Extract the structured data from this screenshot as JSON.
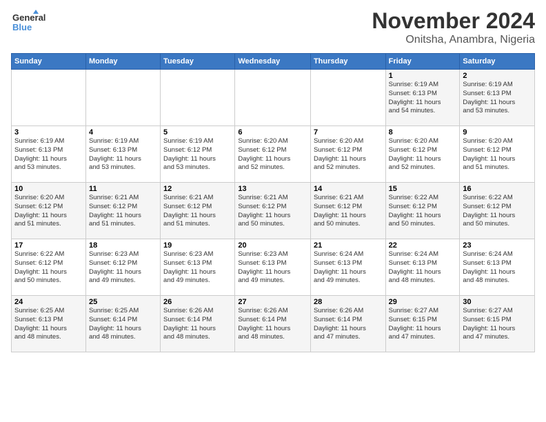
{
  "header": {
    "logo_line1": "General",
    "logo_line2": "Blue",
    "title": "November 2024",
    "subtitle": "Onitsha, Anambra, Nigeria"
  },
  "columns": [
    "Sunday",
    "Monday",
    "Tuesday",
    "Wednesday",
    "Thursday",
    "Friday",
    "Saturday"
  ],
  "weeks": [
    [
      {
        "day": "",
        "info": ""
      },
      {
        "day": "",
        "info": ""
      },
      {
        "day": "",
        "info": ""
      },
      {
        "day": "",
        "info": ""
      },
      {
        "day": "",
        "info": ""
      },
      {
        "day": "1",
        "info": "Sunrise: 6:19 AM\nSunset: 6:13 PM\nDaylight: 11 hours\nand 54 minutes."
      },
      {
        "day": "2",
        "info": "Sunrise: 6:19 AM\nSunset: 6:13 PM\nDaylight: 11 hours\nand 53 minutes."
      }
    ],
    [
      {
        "day": "3",
        "info": "Sunrise: 6:19 AM\nSunset: 6:13 PM\nDaylight: 11 hours\nand 53 minutes."
      },
      {
        "day": "4",
        "info": "Sunrise: 6:19 AM\nSunset: 6:13 PM\nDaylight: 11 hours\nand 53 minutes."
      },
      {
        "day": "5",
        "info": "Sunrise: 6:19 AM\nSunset: 6:12 PM\nDaylight: 11 hours\nand 53 minutes."
      },
      {
        "day": "6",
        "info": "Sunrise: 6:20 AM\nSunset: 6:12 PM\nDaylight: 11 hours\nand 52 minutes."
      },
      {
        "day": "7",
        "info": "Sunrise: 6:20 AM\nSunset: 6:12 PM\nDaylight: 11 hours\nand 52 minutes."
      },
      {
        "day": "8",
        "info": "Sunrise: 6:20 AM\nSunset: 6:12 PM\nDaylight: 11 hours\nand 52 minutes."
      },
      {
        "day": "9",
        "info": "Sunrise: 6:20 AM\nSunset: 6:12 PM\nDaylight: 11 hours\nand 51 minutes."
      }
    ],
    [
      {
        "day": "10",
        "info": "Sunrise: 6:20 AM\nSunset: 6:12 PM\nDaylight: 11 hours\nand 51 minutes."
      },
      {
        "day": "11",
        "info": "Sunrise: 6:21 AM\nSunset: 6:12 PM\nDaylight: 11 hours\nand 51 minutes."
      },
      {
        "day": "12",
        "info": "Sunrise: 6:21 AM\nSunset: 6:12 PM\nDaylight: 11 hours\nand 51 minutes."
      },
      {
        "day": "13",
        "info": "Sunrise: 6:21 AM\nSunset: 6:12 PM\nDaylight: 11 hours\nand 50 minutes."
      },
      {
        "day": "14",
        "info": "Sunrise: 6:21 AM\nSunset: 6:12 PM\nDaylight: 11 hours\nand 50 minutes."
      },
      {
        "day": "15",
        "info": "Sunrise: 6:22 AM\nSunset: 6:12 PM\nDaylight: 11 hours\nand 50 minutes."
      },
      {
        "day": "16",
        "info": "Sunrise: 6:22 AM\nSunset: 6:12 PM\nDaylight: 11 hours\nand 50 minutes."
      }
    ],
    [
      {
        "day": "17",
        "info": "Sunrise: 6:22 AM\nSunset: 6:12 PM\nDaylight: 11 hours\nand 50 minutes."
      },
      {
        "day": "18",
        "info": "Sunrise: 6:23 AM\nSunset: 6:12 PM\nDaylight: 11 hours\nand 49 minutes."
      },
      {
        "day": "19",
        "info": "Sunrise: 6:23 AM\nSunset: 6:13 PM\nDaylight: 11 hours\nand 49 minutes."
      },
      {
        "day": "20",
        "info": "Sunrise: 6:23 AM\nSunset: 6:13 PM\nDaylight: 11 hours\nand 49 minutes."
      },
      {
        "day": "21",
        "info": "Sunrise: 6:24 AM\nSunset: 6:13 PM\nDaylight: 11 hours\nand 49 minutes."
      },
      {
        "day": "22",
        "info": "Sunrise: 6:24 AM\nSunset: 6:13 PM\nDaylight: 11 hours\nand 48 minutes."
      },
      {
        "day": "23",
        "info": "Sunrise: 6:24 AM\nSunset: 6:13 PM\nDaylight: 11 hours\nand 48 minutes."
      }
    ],
    [
      {
        "day": "24",
        "info": "Sunrise: 6:25 AM\nSunset: 6:13 PM\nDaylight: 11 hours\nand 48 minutes."
      },
      {
        "day": "25",
        "info": "Sunrise: 6:25 AM\nSunset: 6:14 PM\nDaylight: 11 hours\nand 48 minutes."
      },
      {
        "day": "26",
        "info": "Sunrise: 6:26 AM\nSunset: 6:14 PM\nDaylight: 11 hours\nand 48 minutes."
      },
      {
        "day": "27",
        "info": "Sunrise: 6:26 AM\nSunset: 6:14 PM\nDaylight: 11 hours\nand 48 minutes."
      },
      {
        "day": "28",
        "info": "Sunrise: 6:26 AM\nSunset: 6:14 PM\nDaylight: 11 hours\nand 47 minutes."
      },
      {
        "day": "29",
        "info": "Sunrise: 6:27 AM\nSunset: 6:15 PM\nDaylight: 11 hours\nand 47 minutes."
      },
      {
        "day": "30",
        "info": "Sunrise: 6:27 AM\nSunset: 6:15 PM\nDaylight: 11 hours\nand 47 minutes."
      }
    ]
  ]
}
